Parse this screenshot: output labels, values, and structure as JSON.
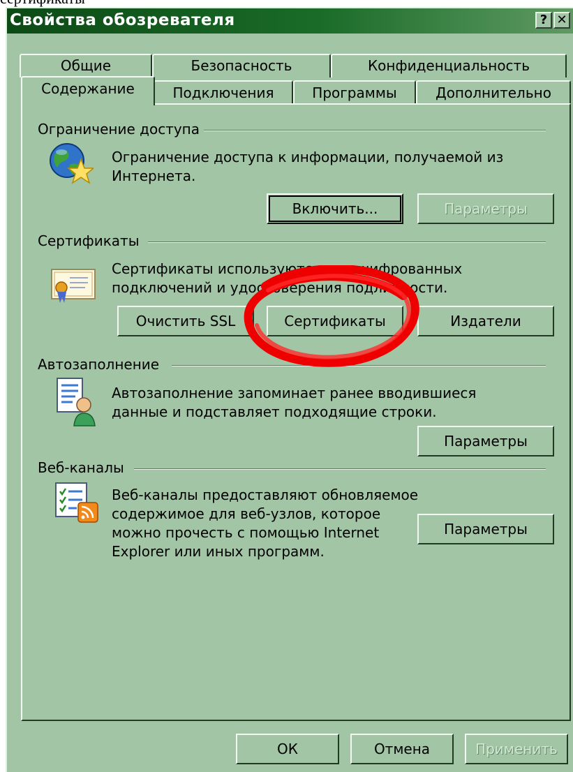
{
  "caption": "сертификаты",
  "window": {
    "title": "Свойства обозревателя",
    "help_button": "?",
    "close_button": "✕"
  },
  "tabs": {
    "row_back": [
      "Общие",
      "Безопасность",
      "Конфиденциальность"
    ],
    "row_front": [
      "Содержание",
      "Подключения",
      "Программы",
      "Дополнительно"
    ],
    "active": "Содержание"
  },
  "access": {
    "heading": "Ограничение доступа",
    "description": "Ограничение доступа к информации, получаемой из\nИнтернета.",
    "enable_button": "Включить...",
    "settings_button": "Параметры"
  },
  "certificates": {
    "heading": "Сертификаты",
    "description": "Сертификаты используются для шифрованных\nподключений и удостоверения подлинности.",
    "clear_ssl_button": "Очистить SSL",
    "certificates_button": "Сертификаты",
    "publishers_button": "Издатели"
  },
  "autocomplete": {
    "heading": "Автозаполнение",
    "description": "Автозаполнение запоминает ранее вводившиеся\nданные и подставляет подходящие строки.",
    "settings_button": "Параметры"
  },
  "feeds": {
    "heading": "Веб-каналы",
    "description": "Веб-каналы предоставляют обновляемое\nсодержимое для веб-узлов, которое\nможно прочесть с помощью Internet\nExplorer или иных программ.",
    "settings_button": "Параметры"
  },
  "footer": {
    "ok_button": "ОК",
    "cancel_button": "Отмена",
    "apply_button": "Применить"
  },
  "colors": {
    "dialog_face": "#a2c5a6",
    "title_bar": "#0d4a16",
    "annotation": "#ee0000"
  },
  "icons": {
    "access": "globe-star-icon",
    "certificates": "certificate-icon",
    "autocomplete": "user-document-icon",
    "feeds": "rss-feed-icon"
  }
}
